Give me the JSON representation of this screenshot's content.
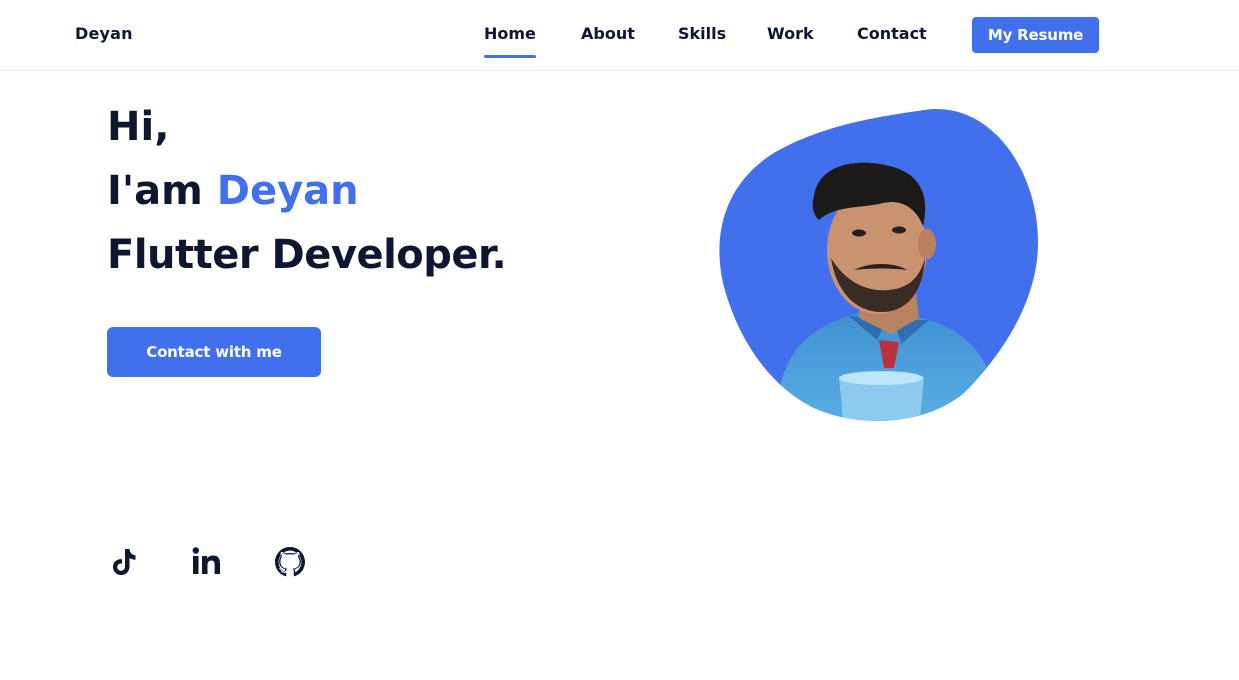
{
  "header": {
    "logo": "Deyan",
    "nav": [
      {
        "label": "Home",
        "active": true
      },
      {
        "label": "About",
        "active": false
      },
      {
        "label": "Skills",
        "active": false
      },
      {
        "label": "Work",
        "active": false
      },
      {
        "label": "Contact",
        "active": false
      }
    ],
    "resume_button": "My Resume"
  },
  "hero": {
    "greeting": "Hi,",
    "intro_prefix": "I'am ",
    "name": "Deyan",
    "role": "Flutter Developer.",
    "contact_button": "Contact with me",
    "photo_icon": "profile-photo-in-blob"
  },
  "social": [
    {
      "icon": "tiktok-icon"
    },
    {
      "icon": "linkedin-icon"
    },
    {
      "icon": "github-icon"
    }
  ],
  "colors": {
    "accent": "#4270ed",
    "text": "#0e1630",
    "background": "#ffffff"
  }
}
